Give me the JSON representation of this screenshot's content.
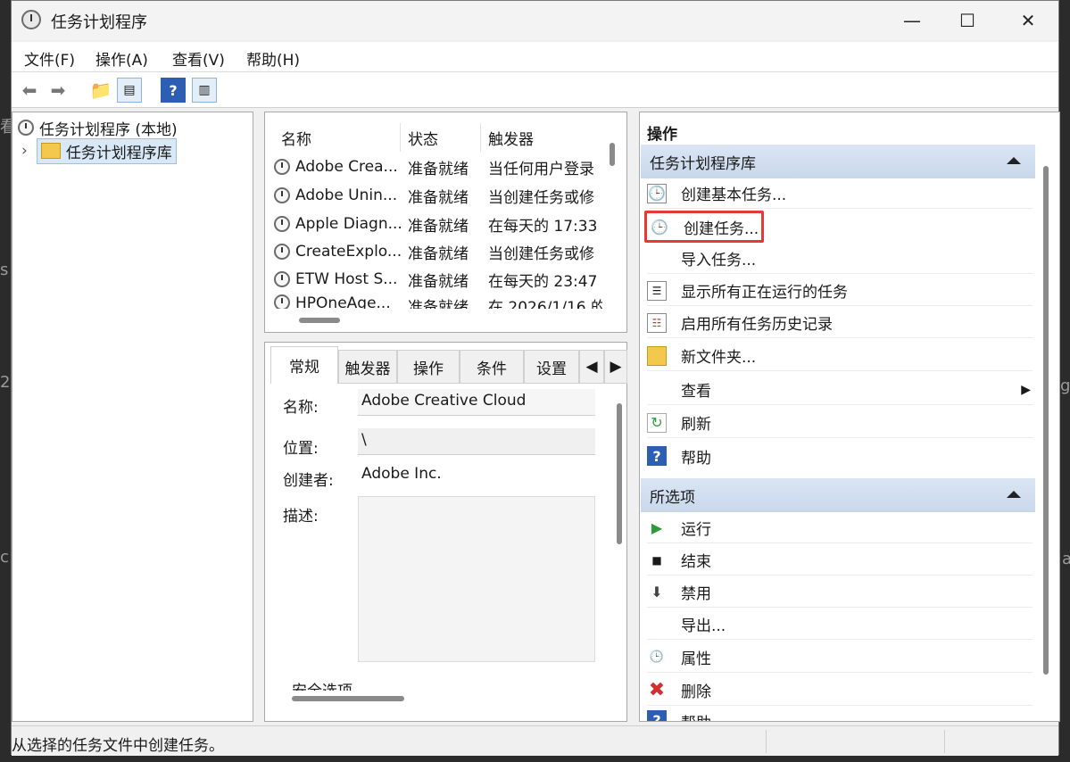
{
  "window": {
    "title": "任务计划程序"
  },
  "menu": {
    "file": "文件(F)",
    "action": "操作(A)",
    "view": "查看(V)",
    "help": "帮助(H)"
  },
  "tree": {
    "root": "任务计划程序 (本地)",
    "library": "任务计划程序库"
  },
  "task_list": {
    "columns": [
      "名称",
      "状态",
      "触发器"
    ],
    "rows": [
      {
        "name": "Adobe Crea...",
        "status": "准备就绪",
        "trigger": "当任何用户登录"
      },
      {
        "name": "Adobe Unin...",
        "status": "准备就绪",
        "trigger": "当创建任务或修"
      },
      {
        "name": "Apple Diagn...",
        "status": "准备就绪",
        "trigger": "在每天的 17:33"
      },
      {
        "name": "CreateExplo...",
        "status": "准备就绪",
        "trigger": "当创建任务或修"
      },
      {
        "name": "ETW Host S...",
        "status": "准备就绪",
        "trigger": "在每天的 23:47"
      },
      {
        "name": "HPOneAge...",
        "status": "准备就绪",
        "trigger": "在 2026/1/16 的"
      }
    ]
  },
  "detail": {
    "tabs": [
      "常规",
      "触发器",
      "操作",
      "条件",
      "设置"
    ],
    "name_label": "名称:",
    "name_value": "Adobe Creative Cloud",
    "location_label": "位置:",
    "location_value": "\\",
    "author_label": "创建者:",
    "author_value": "Adobe Inc.",
    "desc_label": "描述:",
    "security_label": "安全选项"
  },
  "actions": {
    "title": "操作",
    "library_section": "任务计划程序库",
    "library_items": [
      "创建基本任务...",
      "创建任务...",
      "导入任务...",
      "显示所有正在运行的任务",
      "启用所有任务历史记录",
      "新文件夹...",
      "查看",
      "刷新",
      "帮助"
    ],
    "selected_section": "所选项",
    "selected_items": [
      "运行",
      "结束",
      "禁用",
      "导出...",
      "属性",
      "删除",
      "帮助"
    ]
  },
  "status": {
    "text": "从选择的任务文件中创建任务。"
  },
  "background_fragments": {
    "a": "看",
    "b": "s",
    "c": "2",
    "d": "c",
    "e": "g",
    "f": "a"
  },
  "colors": {
    "highlight_box": "#e53935",
    "section_bg": "#cfdcee"
  }
}
